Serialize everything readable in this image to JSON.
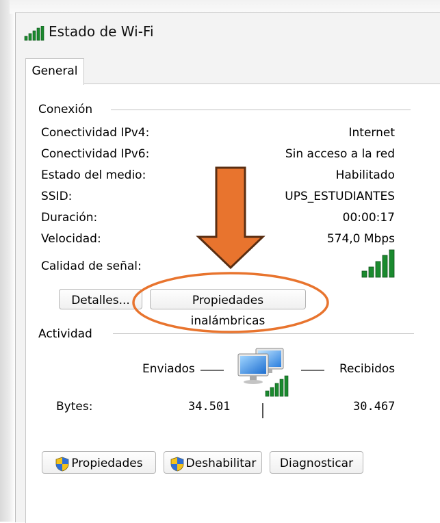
{
  "window": {
    "title": "Estado de Wi-Fi",
    "icon": "wifi-signal-icon"
  },
  "tabs": [
    {
      "label": "General",
      "selected": true
    }
  ],
  "connection": {
    "section_title": "Conexión",
    "rows": [
      {
        "label": "Conectividad IPv4:",
        "value": "Internet"
      },
      {
        "label": "Conectividad IPv6:",
        "value": "Sin acceso a la red"
      },
      {
        "label": "Estado del medio:",
        "value": "Habilitado"
      },
      {
        "label": "SSID:",
        "value": "UPS_ESTUDIANTES"
      },
      {
        "label": "Duración:",
        "value": "00:00:17"
      },
      {
        "label": "Velocidad:",
        "value": "574,0 Mbps"
      }
    ],
    "signal_label": "Calidad de señal:",
    "signal_bars": 5,
    "signal_color": "#1a8a2e"
  },
  "buttons_mid": {
    "details": "Detalles...",
    "wireless_properties": "Propiedades inalámbricas"
  },
  "activity": {
    "section_title": "Actividad",
    "sent_label": "Enviados",
    "received_label": "Recibidos",
    "bytes_label": "Bytes:",
    "bytes_sent": "34.501",
    "bytes_received": "30.467"
  },
  "buttons_bottom": {
    "properties": "Propiedades",
    "disable": "Deshabilitar",
    "diagnose": "Diagnosticar"
  },
  "annotation": {
    "arrow_color": "#e8742e",
    "outline_color": "#5a2e12"
  }
}
